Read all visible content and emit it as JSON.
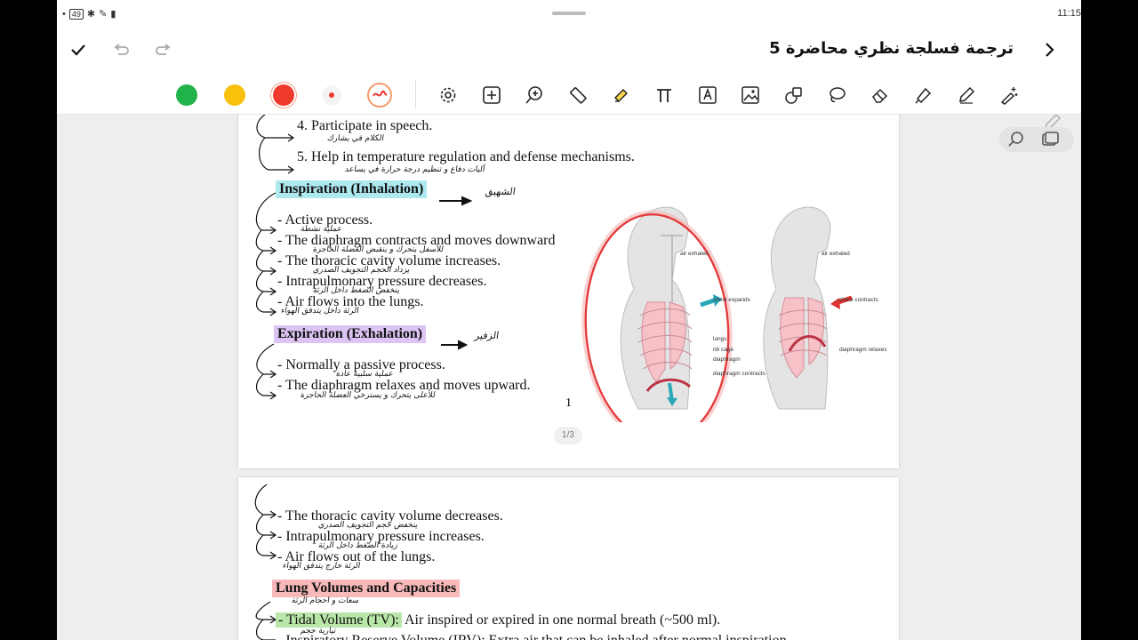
{
  "status_bar": {
    "time": "11:15",
    "battery": "49"
  },
  "header": {
    "title": "ترجمة فسلجة نظري محاضرة 5"
  },
  "toolbar": {
    "colors": [
      "#22b24c",
      "#f9c00c",
      "#ef3b2c"
    ],
    "tools": [
      "settings-icon",
      "add-page-icon",
      "zoom-in-icon",
      "ruler-icon",
      "highlighter-icon",
      "math-pi-icon",
      "text-box-icon",
      "image-icon",
      "shapes-icon",
      "lasso-icon",
      "eraser-icon",
      "marker-icon",
      "pen-icon",
      "magic-pen-icon"
    ]
  },
  "page1": {
    "items": [
      {
        "text": "4.  Participate in speech.",
        "ar": "الكلام   في   يشارك"
      },
      {
        "text": "5.   Help in temperature regulation and defense mechanisms.",
        "ar": "آليات    دفاع    و    تنظيم    درجة حرارة   في   يساعد"
      }
    ],
    "inspiration": {
      "heading": "Inspiration (Inhalation)",
      "heading_ar": "الشهيق",
      "lines": [
        {
          "text": "- Active process.",
          "ar": "عملية  نشطة"
        },
        {
          "text": "- The diaphragm contracts and moves downward",
          "ar": "للأسفل   يتحرك   و   ينقبض   العضلة الحاجزة"
        },
        {
          "text": "- The thoracic cavity volume increases.",
          "ar": "يزداد   الحجم   التجويف   الصدري"
        },
        {
          "text": "- Intrapulmonary pressure decreases.",
          "ar": "ينخفض   الضغط   داخل الرئة"
        },
        {
          "text": "- Air flows into the lungs.",
          "ar": "الرئة   داخل   يتدفق   الهواء"
        }
      ]
    },
    "expiration": {
      "heading": "Expiration (Exhalation)",
      "heading_ar": "الزفير",
      "lines": [
        {
          "text": "- Normally a passive process.",
          "ar": "عملية  سلبية  عادة"
        },
        {
          "text": "- The diaphragm relaxes and moves upward.",
          "ar": "للأعلى   يتحرك   و   يسترخي   العضلة الحاجزة"
        }
      ]
    },
    "page_number": "1",
    "page_indicator": "1/3",
    "figure": {
      "labels_left": [
        "air exhaled",
        "chest expands",
        "lungs",
        "rib cage",
        "diaphragm",
        "diaphragm contracts"
      ],
      "labels_right": [
        "air exhaled",
        "chest contracts",
        "diaphragm relaxes"
      ]
    }
  },
  "page2": {
    "lines": [
      {
        "text": "- The thoracic cavity volume decreases.",
        "ar": "ينخفض   حجم   التجويف   الصدري"
      },
      {
        "text": "- Intrapulmonary pressure increases.",
        "ar": "زيادة   الضغط   داخل الرئة"
      },
      {
        "text": "- Air flows out of the lungs.",
        "ar": "الرئة   خارج   يتدفق   الهواء"
      }
    ],
    "heading": "Lung Volumes and Capacities",
    "heading_ar": "سعات   و   احجام   الرئة",
    "tidal_label": "- Tidal Volume (TV):",
    "tidal_text": " Air inspired or expired in one normal breath (~500 ml).",
    "tidal_ar": "تيارية   حجم",
    "next_line": "- Inspiratory Reserve Volume (IRV): Extra air that can be inhaled after normal inspiration."
  }
}
